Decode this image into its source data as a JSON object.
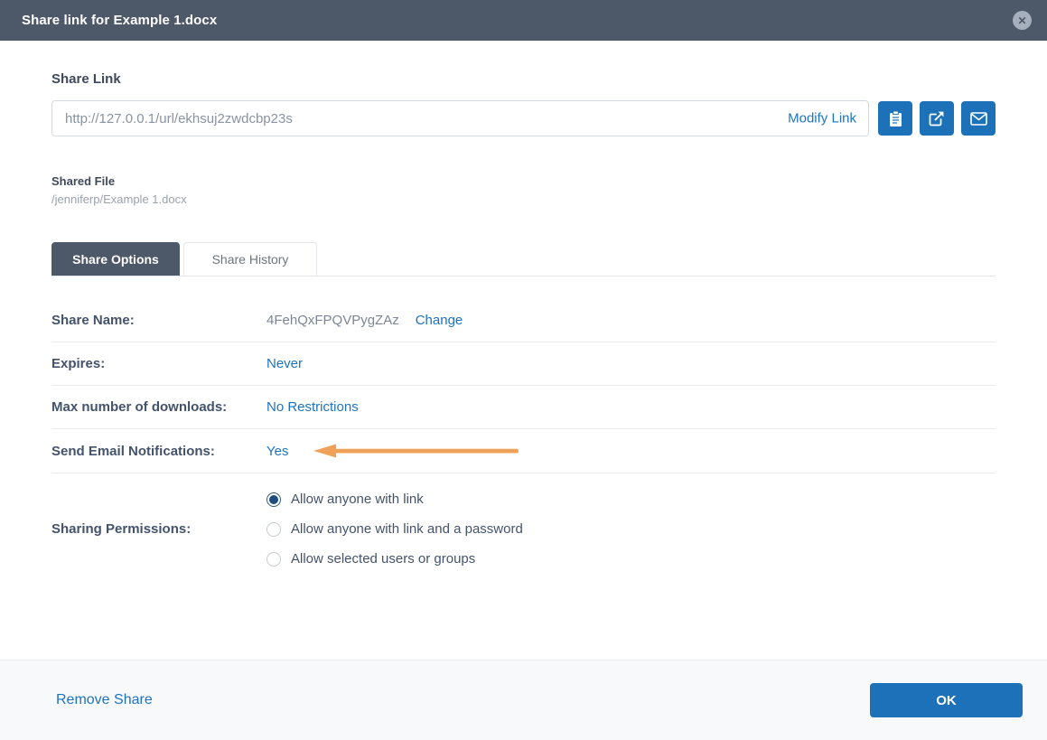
{
  "modal": {
    "title": "Share link for Example 1.docx"
  },
  "icons": {
    "close": "✕"
  },
  "share_link": {
    "label": "Share Link",
    "url": "http://127.0.0.1/url/ekhsuj2zwdcbp23s",
    "modify_link_label": "Modify Link",
    "buttons": [
      "copy-to-clipboard",
      "open-in-new-window",
      "send-by-email"
    ]
  },
  "shared_file": {
    "label": "Shared File",
    "path": "/jenniferp/Example 1.docx"
  },
  "tabs": [
    {
      "label": "Share Options",
      "active": true
    },
    {
      "label": "Share History",
      "active": false
    }
  ],
  "options": {
    "share_name": {
      "label": "Share Name:",
      "value": "4FehQxFPQVPygZAz",
      "action": "Change"
    },
    "expires": {
      "label": "Expires:",
      "value": "Never"
    },
    "max_downloads": {
      "label": "Max number of downloads:",
      "value": "No Restrictions"
    },
    "email_notifications": {
      "label": "Send Email Notifications:",
      "value": "Yes"
    },
    "sharing_permissions": {
      "label": "Sharing Permissions:",
      "choices": [
        {
          "label": "Allow anyone with link",
          "selected": true
        },
        {
          "label": "Allow anyone with link and a password",
          "selected": false
        },
        {
          "label": "Allow selected users or groups",
          "selected": false
        }
      ]
    }
  },
  "footer": {
    "remove_share_label": "Remove Share",
    "ok_label": "OK"
  },
  "colors": {
    "header_bg": "#4D5868",
    "primary_blue": "#1C71B8",
    "link_blue": "#1E73BE",
    "arrow_orange": "#F0A159",
    "radio_selected": "#1C4E7E"
  }
}
